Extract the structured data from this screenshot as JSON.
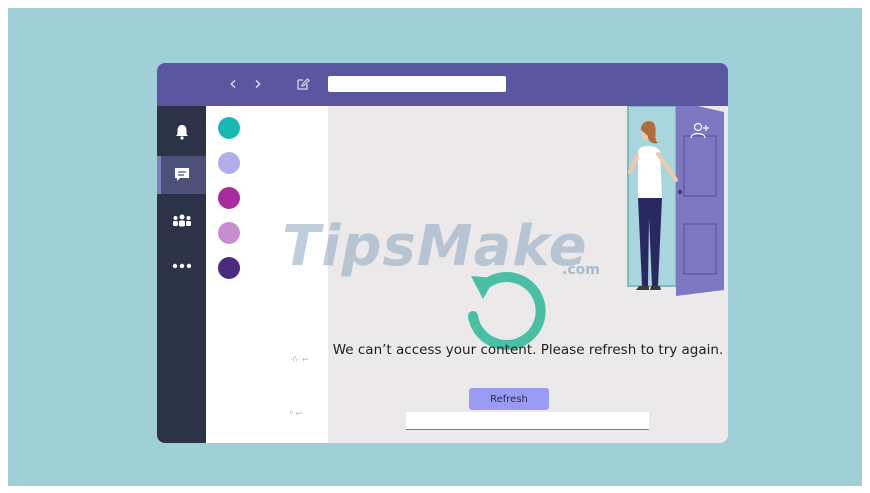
{
  "colors": {
    "background": "#9fcfd7",
    "titlebar": "#5a56a0",
    "rail": "#2c3349",
    "rail_active": "#4d5179",
    "refresh_ring": "#4bbfa3",
    "button": "#9a9bf2"
  },
  "titlebar": {
    "back_icon": "chevron-left-icon",
    "forward_icon": "chevron-right-icon",
    "compose_icon": "compose-icon",
    "search_placeholder": ""
  },
  "rail": {
    "items": [
      {
        "icon": "bell-icon",
        "active": false
      },
      {
        "icon": "chat-icon",
        "active": true
      },
      {
        "icon": "teams-icon",
        "active": false
      },
      {
        "icon": "more-icon",
        "active": false
      }
    ]
  },
  "list": {
    "avatars": [
      "#19b9b3",
      "#b2aee9",
      "#a72d9e",
      "#c88dd0",
      "#4a2b7e"
    ],
    "faint_labels": [
      "·ñ· ↩",
      "ᵇ ↩"
    ]
  },
  "main": {
    "refresh_icon": "refresh-icon",
    "illustration": "person-at-door-illustration",
    "door_icon": "add-person-icon",
    "message": "We can’t access your content. Please refresh to try again.",
    "refresh_button": "Refresh",
    "bottom_input_value": ""
  },
  "watermark": {
    "text": "TipsMake",
    "suffix": ".com"
  }
}
